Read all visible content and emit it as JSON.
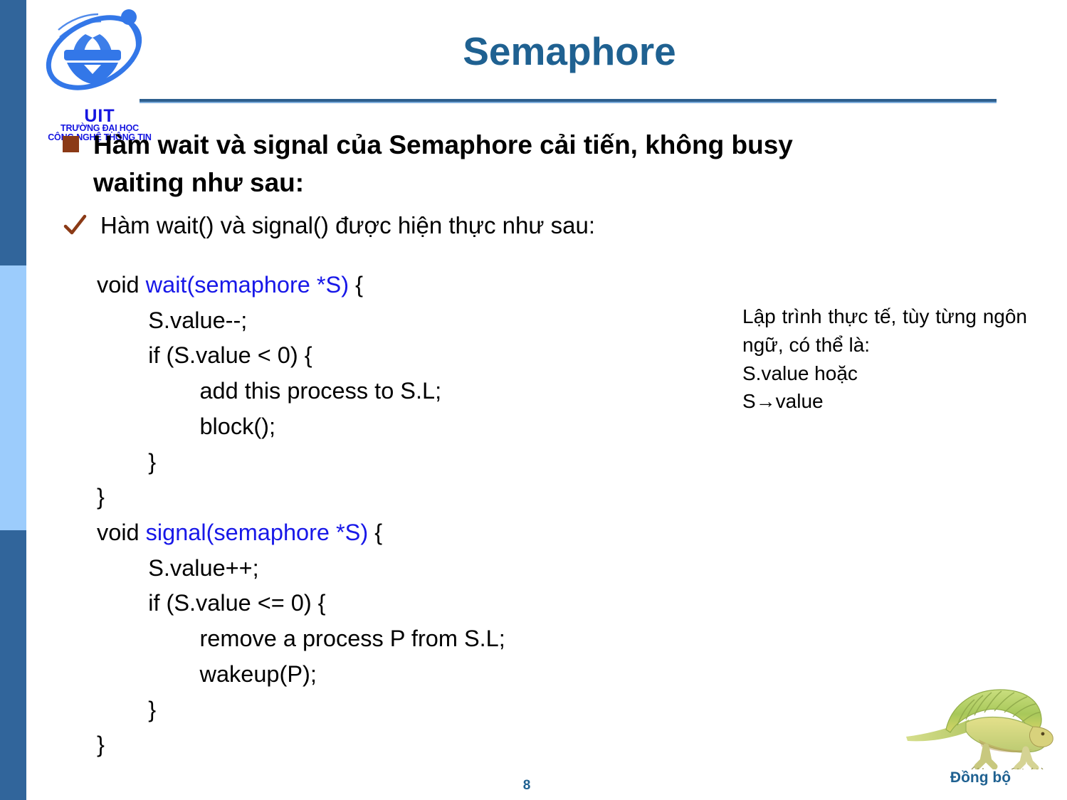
{
  "slide": {
    "title": "Semaphore",
    "page_number": "8",
    "accent_color": "#1F6191",
    "sidebar_dark_color": "#31659B",
    "sidebar_light_color": "#9CCCFC",
    "bullet_square_color": "#8B3A16",
    "check_color": "#8B3A16",
    "code_keyword_color": "#1818E8"
  },
  "logo": {
    "acronym": "UIT",
    "line1": "TRƯỜNG ĐẠI HỌC",
    "line2": "CÔNG NGHỆ THÔNG TIN"
  },
  "bullets": {
    "level1": "Hàm wait và signal của Semaphore cải tiến, không busy waiting như sau:",
    "level2": "Hàm wait() và signal() được hiện thực như sau:"
  },
  "code": {
    "lines": [
      {
        "plain_pre": "void ",
        "keyword": "wait(semaphore *S)",
        "plain_post": " {"
      },
      {
        "plain_pre": "        S.value--;",
        "keyword": "",
        "plain_post": ""
      },
      {
        "plain_pre": "        if (S.value < 0) {",
        "keyword": "",
        "plain_post": ""
      },
      {
        "plain_pre": "                add this process to S.L;",
        "keyword": "",
        "plain_post": ""
      },
      {
        "plain_pre": "                block();",
        "keyword": "",
        "plain_post": ""
      },
      {
        "plain_pre": "        }",
        "keyword": "",
        "plain_post": ""
      },
      {
        "plain_pre": "}",
        "keyword": "",
        "plain_post": ""
      },
      {
        "plain_pre": "void ",
        "keyword": "signal(semaphore *S)",
        "plain_post": " {"
      },
      {
        "plain_pre": "        S.value++;",
        "keyword": "",
        "plain_post": ""
      },
      {
        "plain_pre": "        if (S.value <= 0) {",
        "keyword": "",
        "plain_post": ""
      },
      {
        "plain_pre": "                remove a process P from S.L;",
        "keyword": "",
        "plain_post": ""
      },
      {
        "plain_pre": "                wakeup(P);",
        "keyword": "",
        "plain_post": ""
      },
      {
        "plain_pre": "        }",
        "keyword": "",
        "plain_post": ""
      },
      {
        "plain_pre": "}",
        "keyword": "",
        "plain_post": ""
      }
    ]
  },
  "side_note": {
    "paragraph": "Lập trình thực tế, tùy từng ngôn ngữ, có thể là:",
    "option1": "S.value hoặc",
    "option2": "S→value"
  },
  "mascot": {
    "label": "Đồng bộ",
    "icon": "dinosaur-dimetrodon-icon"
  }
}
